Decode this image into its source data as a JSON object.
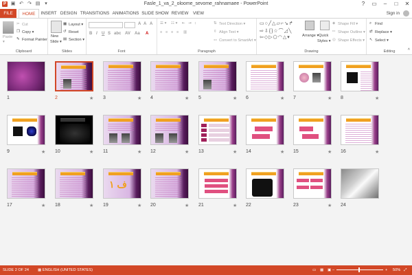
{
  "window": {
    "title": "Fasle_1_va_2_oloome_sevome_rahnamaee - PowerPoint",
    "app_letter": "P"
  },
  "tabs": [
    "FILE",
    "HOME",
    "INSERT",
    "DESIGN",
    "TRANSITIONS",
    "ANIMATIONS",
    "SLIDE SHOW",
    "REVIEW",
    "VIEW"
  ],
  "active_tab": "HOME",
  "account": {
    "signin": "Sign in"
  },
  "ribbon": {
    "clipboard": {
      "label": "Clipboard",
      "paste": "Paste",
      "cut": "Cut",
      "copy": "Copy",
      "format_painter": "Format Painter"
    },
    "slides": {
      "label": "Slides",
      "new_slide": "New",
      "new_slide2": "Slide",
      "layout": "Layout",
      "reset": "Reset",
      "section": "Section"
    },
    "font": {
      "label": "Font"
    },
    "paragraph": {
      "label": "Paragraph",
      "text_direction": "Text Direction",
      "align_text": "Align Text",
      "convert_smartart": "Convert to SmartArt"
    },
    "drawing": {
      "label": "Drawing",
      "arrange": "Arrange",
      "quick_styles": "Quick",
      "quick_styles2": "Styles",
      "shape_fill": "Shape Fill",
      "shape_outline": "Shape Outline",
      "shape_effects": "Shape Effects"
    },
    "editing": {
      "label": "Editing",
      "find": "Find",
      "replace": "Replace",
      "select": "Select"
    }
  },
  "slides": [
    {
      "n": "1"
    },
    {
      "n": "2"
    },
    {
      "n": "3"
    },
    {
      "n": "4"
    },
    {
      "n": "5"
    },
    {
      "n": "6"
    },
    {
      "n": "7"
    },
    {
      "n": "8"
    },
    {
      "n": "9"
    },
    {
      "n": "10"
    },
    {
      "n": "11"
    },
    {
      "n": "12"
    },
    {
      "n": "13"
    },
    {
      "n": "14"
    },
    {
      "n": "15"
    },
    {
      "n": "16"
    },
    {
      "n": "17"
    },
    {
      "n": "18"
    },
    {
      "n": "19"
    },
    {
      "n": "20"
    },
    {
      "n": "21"
    },
    {
      "n": "22"
    },
    {
      "n": "23"
    },
    {
      "n": "24"
    }
  ],
  "selected_slide": "2",
  "status": {
    "slide_of": "SLIDE 2 OF 24",
    "language": "ENGLISH (UNITED STATES)",
    "zoom": "50%"
  },
  "colors": {
    "accent": "#d24726"
  }
}
